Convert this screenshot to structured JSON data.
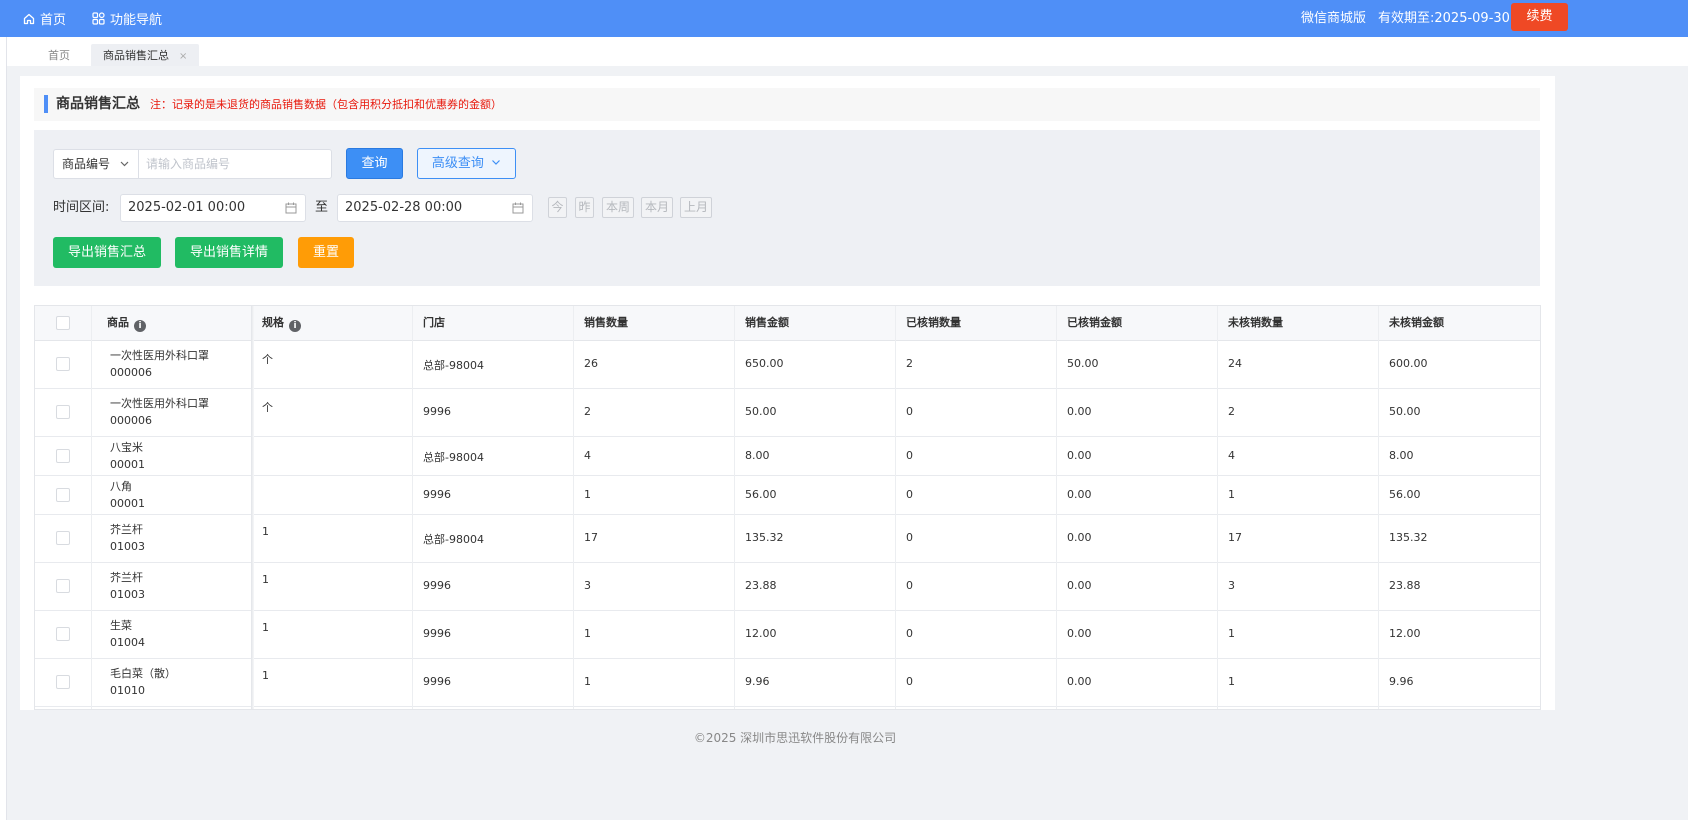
{
  "topbar": {
    "home": "首页",
    "func_nav": "功能导航",
    "edition": "微信商城版",
    "expire": "有效期至:2025-09-30",
    "renew": "续费",
    "color": "#4f8ff7"
  },
  "tabs": {
    "home": "首页",
    "active": "商品销售汇总",
    "close": "×"
  },
  "title": {
    "text": "商品销售汇总",
    "note": "注：记录的是未退货的商品销售数据（包含用积分抵扣和优惠券的金额）"
  },
  "filter": {
    "select_value": "商品编号",
    "search_placeholder": "请输入商品编号",
    "query": "查询",
    "advanced": "高级查询",
    "time_label": "时间区间:",
    "date_from": "2025-02-01 00:00",
    "to": "至",
    "date_to": "2025-02-28 00:00",
    "quick": [
      "今",
      "昨",
      "本周",
      "本月",
      "上月"
    ],
    "export_summary": "导出销售汇总",
    "export_detail": "导出销售详情",
    "reset": "重置"
  },
  "table": {
    "headers": [
      "商品",
      "规格",
      "门店",
      "销售数量",
      "销售金额",
      "已核销数量",
      "已核销金额",
      "未核销数量",
      "未核销金额"
    ],
    "rows": [
      {
        "name": "一次性医用外科口罩",
        "code": "000006",
        "spec": "个",
        "store": "总部-98004",
        "qty": "26",
        "amount": "650.00",
        "ver_qty": "2",
        "ver_amt": "50.00",
        "unver_qty": "24",
        "unver_amt": "600.00"
      },
      {
        "name": "一次性医用外科口罩",
        "code": "000006",
        "spec": "个",
        "store": "9996",
        "qty": "2",
        "amount": "50.00",
        "ver_qty": "0",
        "ver_amt": "0.00",
        "unver_qty": "2",
        "unver_amt": "50.00"
      },
      {
        "name": "八宝米",
        "code": "00001",
        "spec": "",
        "store": "总部-98004",
        "qty": "4",
        "amount": "8.00",
        "ver_qty": "0",
        "ver_amt": "0.00",
        "unver_qty": "4",
        "unver_amt": "8.00"
      },
      {
        "name": "八角",
        "code": "00001",
        "spec": "",
        "store": "9996",
        "qty": "1",
        "amount": "56.00",
        "ver_qty": "0",
        "ver_amt": "0.00",
        "unver_qty": "1",
        "unver_amt": "56.00"
      },
      {
        "name": "芥兰杆",
        "code": "01003",
        "spec": "1",
        "store": "总部-98004",
        "qty": "17",
        "amount": "135.32",
        "ver_qty": "0",
        "ver_amt": "0.00",
        "unver_qty": "17",
        "unver_amt": "135.32"
      },
      {
        "name": "芥兰杆",
        "code": "01003",
        "spec": "1",
        "store": "9996",
        "qty": "3",
        "amount": "23.88",
        "ver_qty": "0",
        "ver_amt": "0.00",
        "unver_qty": "3",
        "unver_amt": "23.88"
      },
      {
        "name": "生菜",
        "code": "01004",
        "spec": "1",
        "store": "9996",
        "qty": "1",
        "amount": "12.00",
        "ver_qty": "0",
        "ver_amt": "0.00",
        "unver_qty": "1",
        "unver_amt": "12.00"
      },
      {
        "name": "毛白菜（散）",
        "code": "01010",
        "spec": "1",
        "store": "9996",
        "qty": "1",
        "amount": "9.96",
        "ver_qty": "0",
        "ver_amt": "0.00",
        "unver_qty": "1",
        "unver_amt": "9.96"
      }
    ]
  },
  "footer": "©2025 深圳市思迅软件股份有限公司"
}
